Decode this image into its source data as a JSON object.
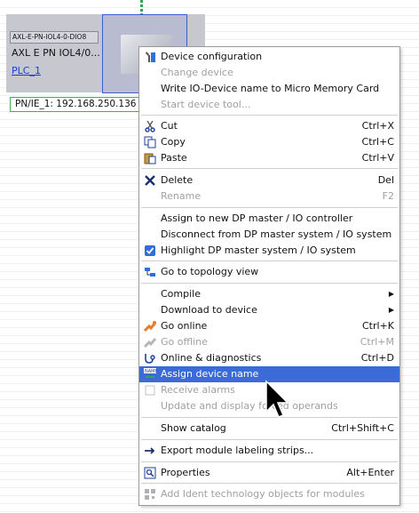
{
  "device": {
    "tag": "AXL-E-PN-IOL4-0-DIO8",
    "name": "AXL E PN IOL4/0...",
    "plc_link": "PLC_1",
    "ip_label": "PN/IE_1:  192.168.250.136"
  },
  "menu": {
    "items": [
      {
        "label": "Device configuration",
        "shortcut": "",
        "icon": "device-config-icon",
        "disabled": false
      },
      {
        "label": "Change device",
        "shortcut": "",
        "disabled": true
      },
      {
        "label": "Write IO-Device name to Micro Memory Card",
        "shortcut": "",
        "disabled": false
      },
      {
        "label": "Start device tool...",
        "shortcut": "",
        "disabled": true
      },
      {
        "label": "Cut",
        "shortcut": "Ctrl+X",
        "icon": "scissors-icon",
        "disabled": false
      },
      {
        "label": "Copy",
        "shortcut": "Ctrl+C",
        "icon": "copy-icon",
        "disabled": false
      },
      {
        "label": "Paste",
        "shortcut": "Ctrl+V",
        "icon": "paste-icon",
        "disabled": false
      },
      {
        "label": "Delete",
        "shortcut": "Del",
        "icon": "delete-icon",
        "disabled": false
      },
      {
        "label": "Rename",
        "shortcut": "F2",
        "disabled": true
      },
      {
        "label": "Assign to new DP master / IO controller",
        "shortcut": "",
        "disabled": false
      },
      {
        "label": "Disconnect from DP master system / IO system",
        "shortcut": "",
        "disabled": false
      },
      {
        "label": "Highlight DP master system / IO system",
        "shortcut": "",
        "icon": "checkbox-icon",
        "disabled": false
      },
      {
        "label": "Go to topology view",
        "shortcut": "",
        "icon": "topology-icon",
        "disabled": false
      },
      {
        "label": "Compile",
        "shortcut": "",
        "submenu": true,
        "disabled": false
      },
      {
        "label": "Download to device",
        "shortcut": "",
        "submenu": true,
        "disabled": false
      },
      {
        "label": "Go online",
        "shortcut": "Ctrl+K",
        "icon": "go-online-icon",
        "disabled": false
      },
      {
        "label": "Go offline",
        "shortcut": "Ctrl+M",
        "icon": "go-offline-icon",
        "disabled": true
      },
      {
        "label": "Online & diagnostics",
        "shortcut": "Ctrl+D",
        "icon": "diagnostics-icon",
        "disabled": false
      },
      {
        "label": "Assign device name",
        "shortcut": "",
        "icon": "name-icon",
        "disabled": false,
        "selected": true
      },
      {
        "label": "Receive alarms",
        "shortcut": "",
        "icon": "alarm-icon",
        "disabled": true
      },
      {
        "label": "Update and display forced operands",
        "shortcut": "",
        "disabled": true
      },
      {
        "label": "Show catalog",
        "shortcut": "Ctrl+Shift+C",
        "disabled": false
      },
      {
        "label": "Export module labeling strips...",
        "shortcut": "",
        "icon": "export-icon",
        "disabled": false
      },
      {
        "label": "Properties",
        "shortcut": "Alt+Enter",
        "icon": "properties-icon",
        "disabled": false
      },
      {
        "label": "Add Ident technology objects for modules",
        "shortcut": "",
        "icon": "ident-icon",
        "disabled": true
      }
    ]
  },
  "colors": {
    "selection": "#3b6bd6",
    "network_line": "#2ea84a",
    "ip_border": "#3ab54a",
    "link": "#1a3cd6"
  }
}
